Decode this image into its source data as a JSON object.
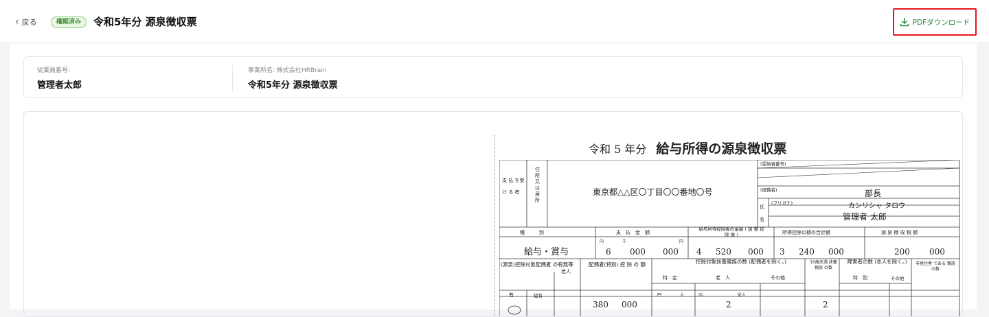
{
  "header": {
    "back_label": "戻る",
    "status_badge": "確認済み",
    "title": "令和5年分 源泉徴収票",
    "pdf_button_label": "PDFダウンロード"
  },
  "info": {
    "employee_label": "従業員番号:",
    "employee_value": "管理者太郎",
    "office_label": "事業所名: 株式会社HRBrain",
    "office_value": "令和5年分 源泉徴収票"
  },
  "slip": {
    "title_prefix": "令和 5 年分",
    "title_main": "給与所得の源泉徴収票",
    "payee_label": "支 払 を受け る 者",
    "address_label": "住所又は居所",
    "address": "東京都△△区〇丁目〇〇番地〇号",
    "recipient_no_label": "(受給者番号)",
    "position_label": "(役職名)",
    "position": "部長",
    "name_label": "氏 名",
    "furigana_label": "(フリガナ)",
    "furigana": "カンリシャ タロウ",
    "name": "管理者 太郎",
    "col_type": "種　　　別",
    "col_payment": "支　払　金　額",
    "col_income": "給与所得控除後の金額 ( 調 整 控 除 後 )",
    "col_deduction_total": "所得控除の額の合計額",
    "col_withholding": "源 泉 徴 収 税 額",
    "payment_type": "給与・賞与",
    "payment_amount": [
      "6",
      "000",
      "000"
    ],
    "income_amount": [
      "4",
      "520",
      "000"
    ],
    "deduction_total": [
      "3",
      "240",
      "000"
    ],
    "withholding": [
      "200",
      "000"
    ],
    "spouse_label": "(源泉)控除対象配偶者 の有無等",
    "elderly_label": "老人",
    "spouse_deduction_label": "配偶者(特別) 控 除 の 額",
    "dependents_label": "控除対象扶養親族の数 (配偶者を除く。)",
    "specific_label": "特　定",
    "elderly2_label": "老　人",
    "other_label": "その他",
    "under16_label": "16歳未満 扶養親族 の数",
    "disabled_label": "障害者の数 (本人を除く。)",
    "special_label": "特　別",
    "other2_label": "その他",
    "nonresident_label": "非居住者 である 親族の数",
    "yes_label": "有",
    "no_label": "従有",
    "spouse_amount": [
      "380",
      "000"
    ],
    "elderly_count": "2",
    "under16_count": "2",
    "unit_thousand": "千",
    "unit_yen": "円",
    "unit_person": "人",
    "unit_inner": "内",
    "unit_dependent": "従人"
  }
}
